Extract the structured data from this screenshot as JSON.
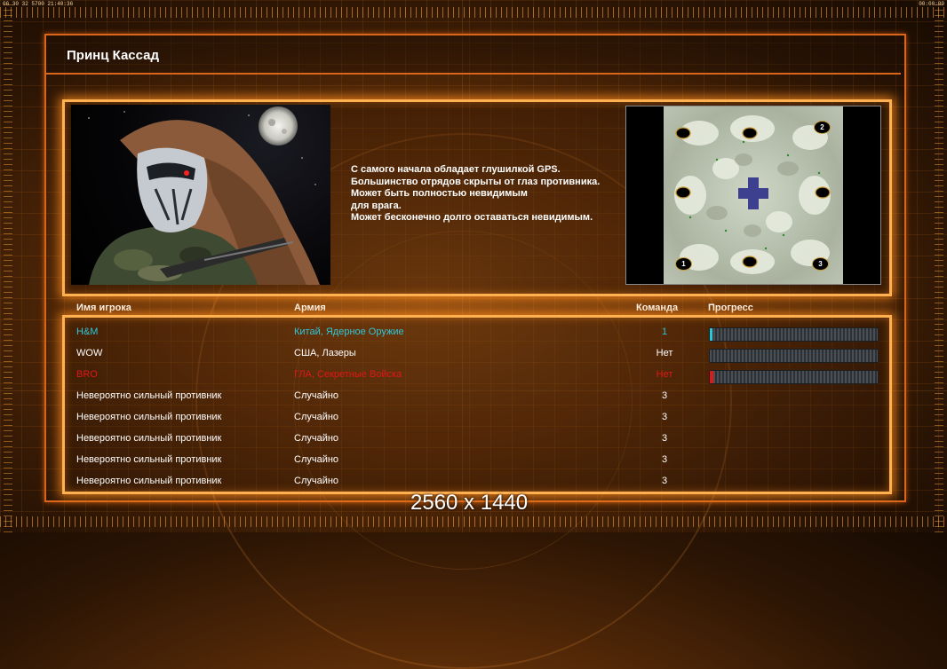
{
  "hud": {
    "left": "06 30 32 5700 21:40:36",
    "right": "00:00:00"
  },
  "title": "Принц Кассад",
  "description": [
    "С самого начала обладает глушилкой GPS.",
    "Большинство отрядов скрыты от глаз противника.",
    "Может быть полностью невидимым",
    "для врага.",
    "Может бесконечно долго оставаться невидимым."
  ],
  "map": {
    "markers": [
      "2",
      "1",
      "3"
    ]
  },
  "table": {
    "headers": {
      "name": "Имя игрока",
      "army": "Армия",
      "team": "Команда",
      "progress": "Прогресс"
    },
    "rows": [
      {
        "name": "H&M",
        "army": "Китай, Ядерное Оружие",
        "team": "1",
        "color": "#2fc8d8",
        "progress": 0.01,
        "show_bar": true
      },
      {
        "name": "WOW",
        "army": "США, Лазеры",
        "team": "Нет",
        "color": "#ffffff",
        "progress": 0.0,
        "show_bar": true
      },
      {
        "name": "BRO",
        "army": "ГЛА, Секретные Войска",
        "team": "Нет",
        "color": "#e01818",
        "progress": 0.02,
        "show_bar": true
      },
      {
        "name": "Невероятно сильный противник",
        "army": "Случайно",
        "team": "3",
        "color": "#ffffff",
        "show_bar": false
      },
      {
        "name": "Невероятно сильный противник",
        "army": "Случайно",
        "team": "3",
        "color": "#ffffff",
        "show_bar": false
      },
      {
        "name": "Невероятно сильный противник",
        "army": "Случайно",
        "team": "3",
        "color": "#ffffff",
        "show_bar": false
      },
      {
        "name": "Невероятно сильный противник",
        "army": "Случайно",
        "team": "3",
        "color": "#ffffff",
        "show_bar": false
      },
      {
        "name": "Невероятно сильный противник",
        "army": "Случайно",
        "team": "3",
        "color": "#ffffff",
        "show_bar": false
      }
    ]
  },
  "resolution_label": "2560 x 1440",
  "colors": {
    "accent": "#d9661a",
    "glow": "#ffb050"
  }
}
